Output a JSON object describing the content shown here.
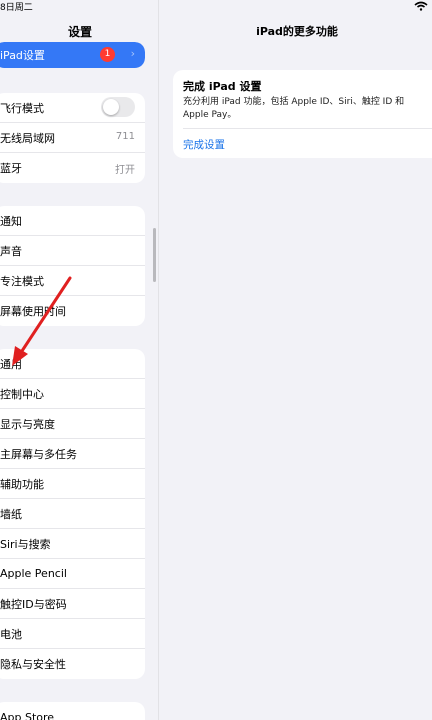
{
  "status": {
    "date": "8日周二"
  },
  "sidebar": {
    "title": "设置",
    "selected": {
      "label": "iPad设置",
      "badge": "1"
    },
    "group1": [
      {
        "label": "飞行模式",
        "toggle": false
      },
      {
        "label": "无线局域网",
        "value": "711"
      },
      {
        "label": "蓝牙",
        "value": "打开"
      }
    ],
    "group2": [
      {
        "label": "通知"
      },
      {
        "label": "声音"
      },
      {
        "label": "专注模式"
      },
      {
        "label": "屏幕使用时间"
      }
    ],
    "group3": [
      {
        "label": "通用"
      },
      {
        "label": "控制中心"
      },
      {
        "label": "显示与亮度"
      },
      {
        "label": "主屏幕与多任务"
      },
      {
        "label": "辅助功能"
      },
      {
        "label": "墙纸"
      },
      {
        "label": "Siri与搜索"
      },
      {
        "label": "Apple Pencil"
      },
      {
        "label": "触控ID与密码"
      },
      {
        "label": "电池"
      },
      {
        "label": "隐私与安全性"
      }
    ],
    "group4": [
      {
        "label": "App Store"
      }
    ]
  },
  "panel": {
    "title": "iPad的更多功能",
    "card": {
      "title": "完成 iPad 设置",
      "body": "充分利用 iPad 功能，包括 Apple ID、Siri、触控 ID 和 Apple Pay。",
      "link": "完成设置"
    }
  },
  "colors": {
    "accent": "#3478f6",
    "badge": "#ff3b30",
    "arrow": "#e02020",
    "link": "#1a73e8"
  }
}
